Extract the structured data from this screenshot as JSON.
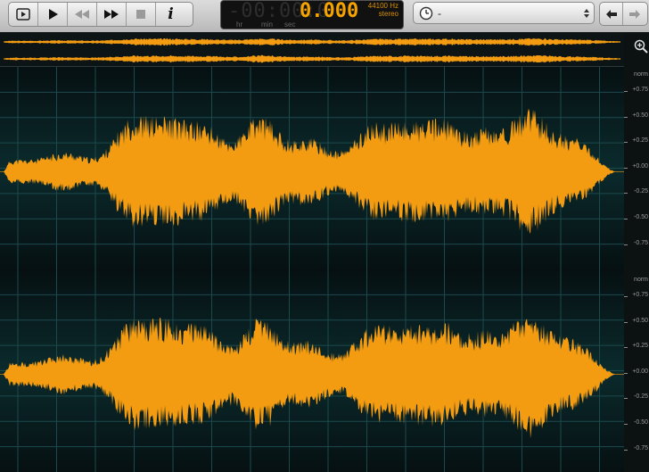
{
  "toolbar": {
    "buttons": [
      {
        "name": "preview-button",
        "icon": "preview-icon"
      },
      {
        "name": "play-button",
        "icon": "play-icon"
      },
      {
        "name": "rewind-button",
        "icon": "rewind-icon"
      },
      {
        "name": "fast-forward-button",
        "icon": "fast-forward-icon"
      },
      {
        "name": "stop-button",
        "icon": "stop-icon"
      },
      {
        "name": "info-button",
        "icon": "info-icon"
      }
    ],
    "info_label": "i",
    "time_ghost": "-00:00:0",
    "time_value": "0.000",
    "unit_hr": "hr",
    "unit_min": "min",
    "unit_sec": "sec",
    "sample_rate": "44100 Hz",
    "channel_mode": "stereo",
    "dropdown_value": "-"
  },
  "waveform": {
    "color": "#f39c12",
    "background": "#0b2a2c",
    "channels": 2
  },
  "ruler": {
    "channel_top": {
      "header": "norm",
      "ticks": [
        "+0.75",
        "+0.50",
        "+0.25",
        "+0.00",
        "-0.25",
        "-0.50",
        "-0.75"
      ]
    },
    "channel_bottom": {
      "header": "norm",
      "ticks": [
        "+0.75",
        "+0.50",
        "+0.25",
        "+0.00",
        "-0.25",
        "-0.50",
        "-0.75"
      ]
    }
  }
}
